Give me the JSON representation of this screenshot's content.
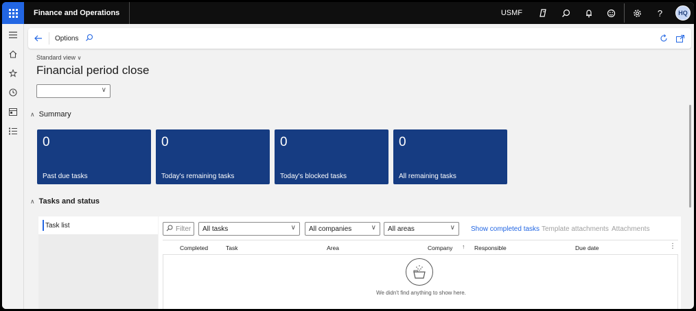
{
  "topbar": {
    "app_title": "Finance and Operations",
    "company": "USMF",
    "avatar_initials": "HQ",
    "icons": [
      "copilot-icon",
      "search-icon",
      "bell-icon",
      "smiley-icon",
      "gear-icon",
      "help-icon"
    ],
    "help_glyph": "?"
  },
  "leftnav": {
    "icons": [
      "hamburger-icon",
      "home-icon",
      "star-icon",
      "recent-icon",
      "workspaces-icon",
      "modules-icon"
    ]
  },
  "actionbar": {
    "title": "Options"
  },
  "page": {
    "view_selector": "Standard view",
    "title": "Financial period close",
    "top_dropdown_value": ""
  },
  "summary": {
    "header": "Summary",
    "tiles": [
      {
        "value": "0",
        "label": "Past due tasks"
      },
      {
        "value": "0",
        "label": "Today's remaining tasks"
      },
      {
        "value": "0",
        "label": "Today's blocked tasks"
      },
      {
        "value": "0",
        "label": "All remaining tasks"
      }
    ]
  },
  "tasks": {
    "header": "Tasks and status",
    "task_list_label": "Task list",
    "filter_placeholder": "Filter",
    "dropdowns": [
      "All tasks",
      "All companies",
      "All areas"
    ],
    "links": {
      "show_completed": "Show completed tasks",
      "template_attachments": "Template attachments",
      "attachments": "Attachments"
    },
    "columns": [
      "Completed",
      "Task",
      "Area",
      "Company",
      "Responsible",
      "Due date"
    ],
    "empty_message": "We didn't find anything to show here."
  },
  "colors": {
    "accent": "#2266e3",
    "tile_bg": "#163c82",
    "topbar_bg": "#0f0f0f",
    "disabled_link": "#a0a0a0"
  }
}
